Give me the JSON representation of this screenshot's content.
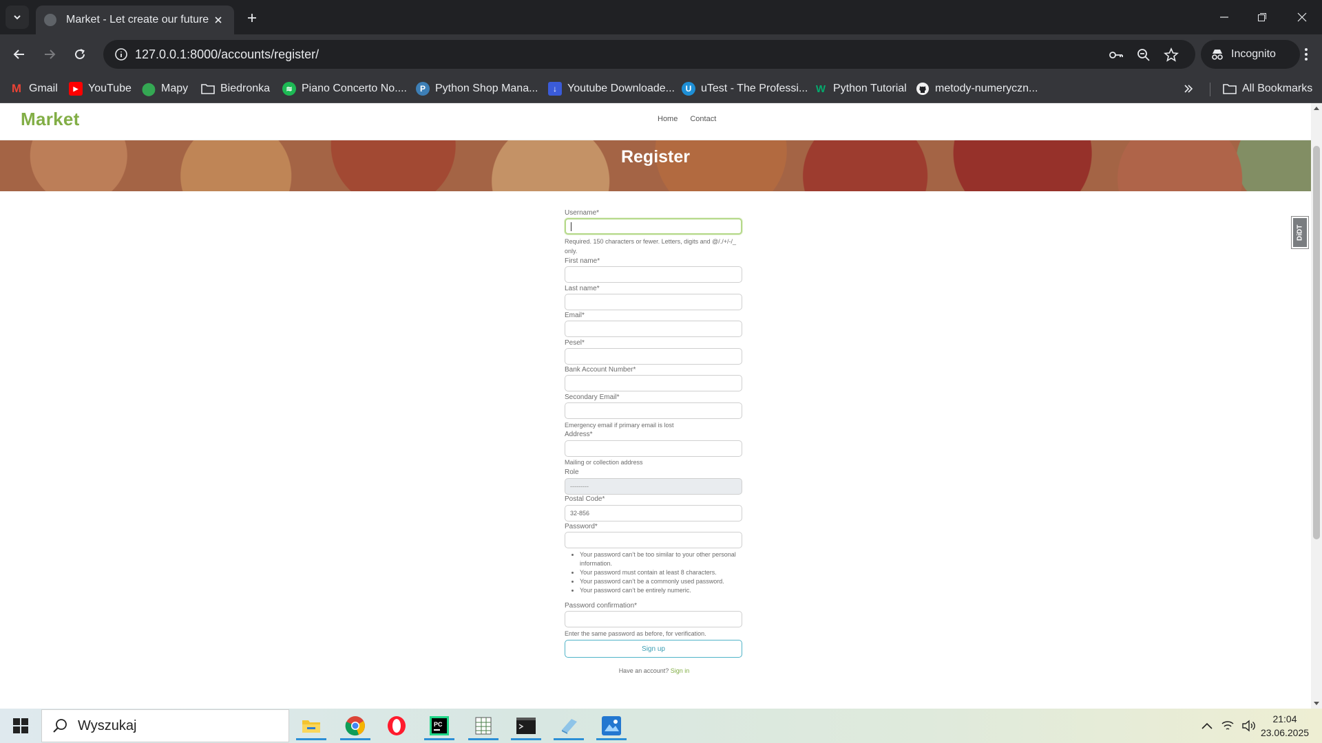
{
  "browser": {
    "tab_title": "Market - Let create our future",
    "url": "127.0.0.1:8000/accounts/register/",
    "incognito_label": "Incognito",
    "all_bookmarks_label": "All Bookmarks",
    "bookmarks": [
      {
        "label": "Gmail",
        "icon": "gmail-icon",
        "color": "#ea4335",
        "glyph": "M"
      },
      {
        "label": "YouTube",
        "icon": "youtube-icon",
        "color": "#ff0000",
        "glyph": "▶"
      },
      {
        "label": "Mapy",
        "icon": "maps-icon",
        "color": "#34a853",
        "glyph": "●"
      },
      {
        "label": "Biedronka",
        "icon": "folder-icon",
        "color": "transparent",
        "glyph": ""
      },
      {
        "label": "Piano Concerto No....",
        "icon": "spotify-icon",
        "color": "#1db954",
        "glyph": "≋"
      },
      {
        "label": "Python Shop Mana...",
        "icon": "python-icon",
        "color": "#3d7fb6",
        "glyph": "P"
      },
      {
        "label": "Youtube Downloade...",
        "icon": "download-icon",
        "color": "#3a5bd9",
        "glyph": "↓"
      },
      {
        "label": "uTest - The Professi...",
        "icon": "utest-icon",
        "color": "#1e8fd6",
        "glyph": "U"
      },
      {
        "label": "Python Tutorial",
        "icon": "w3schools-icon",
        "color": "#04aa6d",
        "glyph": "W"
      },
      {
        "label": "metody-numeryczn...",
        "icon": "github-icon",
        "color": "#f0f0f0",
        "glyph": "●"
      }
    ]
  },
  "site": {
    "brand": "Market",
    "nav": {
      "home": "Home",
      "contact": "Contact"
    },
    "hero_title": "Register",
    "accent": "#82ae46"
  },
  "form": {
    "username": {
      "label": "Username*",
      "help": "Required. 150 characters or fewer. Letters, digits and @/./+/-/_ only."
    },
    "first_name": {
      "label": "First name*"
    },
    "last_name": {
      "label": "Last name*"
    },
    "email": {
      "label": "Email*"
    },
    "pesel": {
      "label": "Pesel*"
    },
    "bank_account": {
      "label": "Bank Account Number*"
    },
    "secondary_email": {
      "label": "Secondary Email*",
      "help": "Emergency email if primary email is lost"
    },
    "address": {
      "label": "Address*",
      "help": "Mailing or collection address"
    },
    "role": {
      "label": "Role",
      "value": "---------"
    },
    "postal_code": {
      "label": "Postal Code*",
      "placeholder": "32-856"
    },
    "password": {
      "label": "Password*",
      "rules": [
        "Your password can’t be too similar to your other personal information.",
        "Your password must contain at least 8 characters.",
        "Your password can’t be a commonly used password.",
        "Your password can’t be entirely numeric."
      ]
    },
    "password_confirmation": {
      "label": "Password confirmation*",
      "help": "Enter the same password as before, for verification."
    },
    "submit": "Sign up",
    "have_account": "Have an account?",
    "sign_in": "Sign in"
  },
  "extension_badge": "DiDT",
  "taskbar": {
    "search_placeholder": "Wyszukaj",
    "time": "21:04",
    "date": "23.06.2025"
  }
}
